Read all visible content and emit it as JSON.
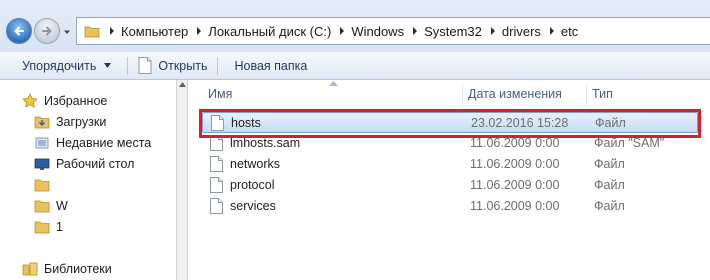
{
  "address": {
    "crumbs": [
      "Компьютер",
      "Локальный диск (C:)",
      "Windows",
      "System32",
      "drivers",
      "etc"
    ]
  },
  "toolbar": {
    "organize_label": "Упорядочить",
    "open_label": "Открыть",
    "new_folder_label": "Новая папка"
  },
  "nav": {
    "favorites_label": "Избранное",
    "downloads_label": "Загрузки",
    "recent_label": "Недавние места",
    "desktop_label": "Рабочий стол",
    "folder_blank_label": "",
    "folder_w_label": "W",
    "folder_1_label": "1",
    "libraries_label": "Библиотеки"
  },
  "columns": {
    "name": "Имя",
    "date": "Дата изменения",
    "type": "Тип"
  },
  "files": [
    {
      "name": "hosts",
      "date": "23.02.2016 15:28",
      "type": "Файл",
      "selected": true
    },
    {
      "name": "lmhosts.sam",
      "date": "11.06.2009 0:00",
      "type": "Файл \"SAM\"",
      "selected": false
    },
    {
      "name": "networks",
      "date": "11.06.2009 0:00",
      "type": "Файл",
      "selected": false
    },
    {
      "name": "protocol",
      "date": "11.06.2009 0:00",
      "type": "Файл",
      "selected": false
    },
    {
      "name": "services",
      "date": "11.06.2009 0:00",
      "type": "Файл",
      "selected": false
    }
  ],
  "colors": {
    "highlight": "#d2232a",
    "selection": "#c4dcf6"
  }
}
